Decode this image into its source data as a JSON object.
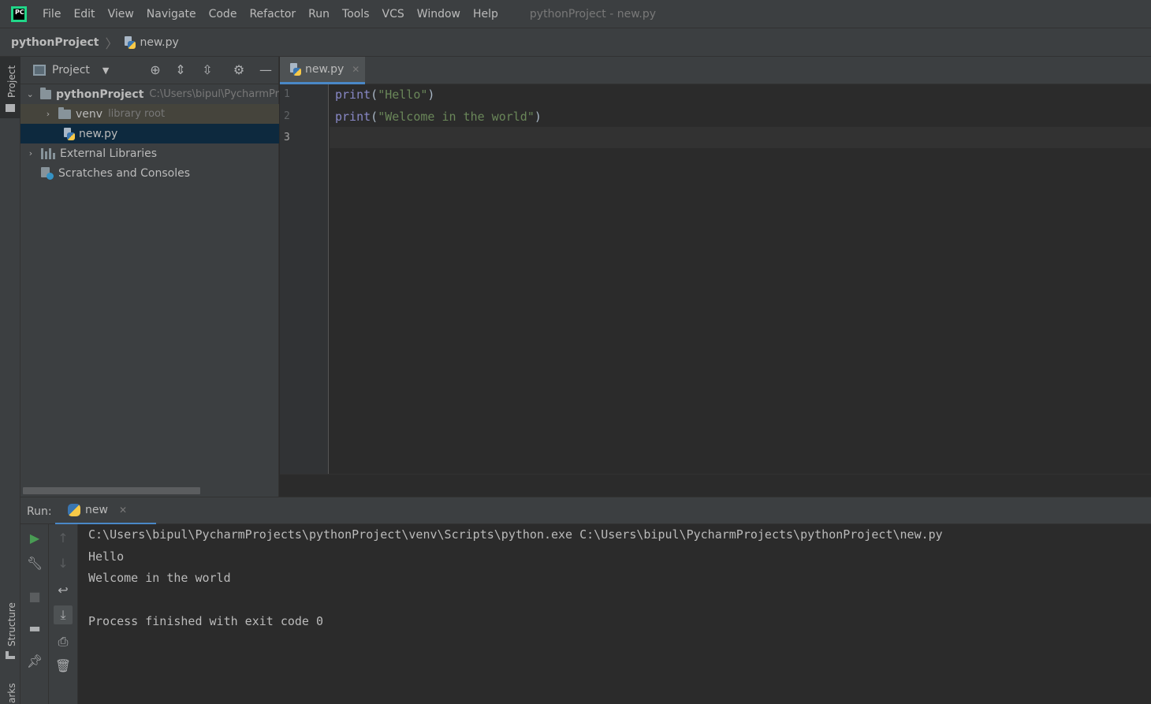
{
  "app": {
    "logo_text": "PC",
    "window_title": "pythonProject - new.py",
    "menu": [
      "File",
      "Edit",
      "View",
      "Navigate",
      "Code",
      "Refactor",
      "Run",
      "Tools",
      "VCS",
      "Window",
      "Help"
    ]
  },
  "breadcrumb": {
    "project": "pythonProject",
    "file": "new.py"
  },
  "side_stripe": {
    "project": "Project",
    "structure": "Structure",
    "bookmarks": "arks"
  },
  "project_panel": {
    "title": "Project",
    "tree": {
      "root_name": "pythonProject",
      "root_path": "C:\\Users\\bipul\\PycharmPr",
      "venv_name": "venv",
      "venv_hint": "library root",
      "file": "new.py",
      "external": "External Libraries",
      "scratches": "Scratches and Consoles"
    }
  },
  "editor": {
    "tab": "new.py",
    "line_numbers": [
      "1",
      "2",
      "3"
    ],
    "code": [
      {
        "fn": "print",
        "open": "(",
        "str": "\"Hello\"",
        "close": ")"
      },
      {
        "fn": "print",
        "open": "(",
        "str": "\"Welcome in the world\"",
        "close": ")"
      }
    ]
  },
  "run": {
    "label": "Run:",
    "tab": "new",
    "console": [
      "C:\\Users\\bipul\\PycharmProjects\\pythonProject\\venv\\Scripts\\python.exe C:\\Users\\bipul\\PycharmProjects\\pythonProject\\new.py",
      "Hello",
      "Welcome in the world",
      "Process finished with exit code 0"
    ]
  },
  "colors": {
    "background": "#2b2b2b",
    "panel": "#3c3f41",
    "selection": "#0d293e",
    "keyword": "#8888c6",
    "string": "#6a8759",
    "accent": "#4a88c7"
  }
}
